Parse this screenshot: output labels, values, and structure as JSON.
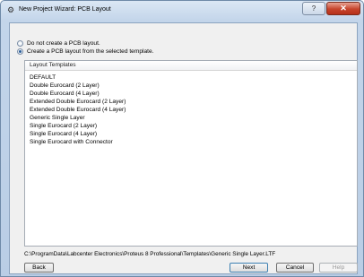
{
  "window": {
    "title": "New Project Wizard: PCB Layout",
    "help_label": "?",
    "close_label": "✕"
  },
  "options": {
    "no_pcb_label": "Do not create a PCB layout.",
    "from_template_label": "Create a PCB layout from the selected template.",
    "selected": "from_template"
  },
  "templates": {
    "header": "Layout Templates",
    "items": [
      "DEFAULT",
      "Double Eurocard (2 Layer)",
      "Double Eurocard (4 Layer)",
      "Extended Double Eurocard (2 Layer)",
      "Extended Double Eurocard (4 Layer)",
      "Generic Single Layer",
      "Single Eurocard (2 Layer)",
      "Single Eurocard (4 Layer)",
      "Single Eurocard with Connector"
    ]
  },
  "path": "C:\\ProgramData\\Labcenter Electronics\\Proteus 8 Professional\\Templates\\Generic Single Layer.LTF",
  "buttons": {
    "back": "Back",
    "next": "Next",
    "cancel": "Cancel",
    "help": "Help"
  }
}
